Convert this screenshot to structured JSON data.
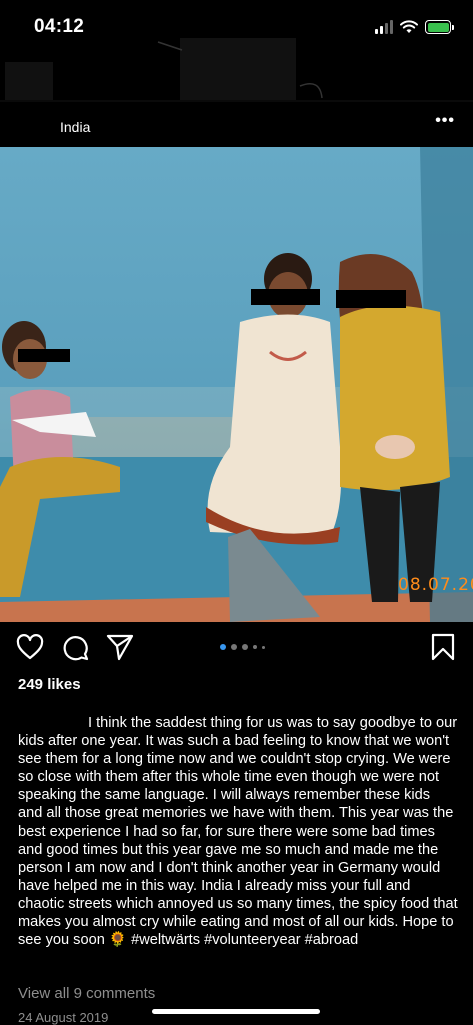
{
  "status_bar": {
    "time": "04:12",
    "battery_color": "#3ac04e"
  },
  "post": {
    "location": "India",
    "photo_date_stamp": "08.07.20",
    "likes": "249 likes",
    "caption": "I think the saddest thing for us was to say goodbye to our kids after one year. It was such a bad feeling to know that we won't see them for a long time now and we couldn't stop crying. We were so close with them after this whole time even though we were not speaking the same language. I will always remember these kids and all those great memories we have with them. This year was the best experience I had so far, for sure there were some bad times and good times but this year gave me so much and made me the person I am now and I don't think another year in Germany would have helped me in this way. India I already miss your full and chaotic streets which annoyed us so many times, the spicy food that makes you almost cry while eating and most of all our kids. Hope to see you soon 🌻 #weltwärts #volunteeryear #abroad",
    "view_comments": "View all 9 comments",
    "date": "24 August 2019",
    "carousel": {
      "count": 5,
      "active_index": 0
    }
  },
  "icons": [
    "like-icon",
    "comment-icon",
    "share-icon",
    "save-icon",
    "more-icon"
  ],
  "colors": {
    "accent_dot": "#3897f0",
    "muted_text": "#8e8e8e"
  }
}
